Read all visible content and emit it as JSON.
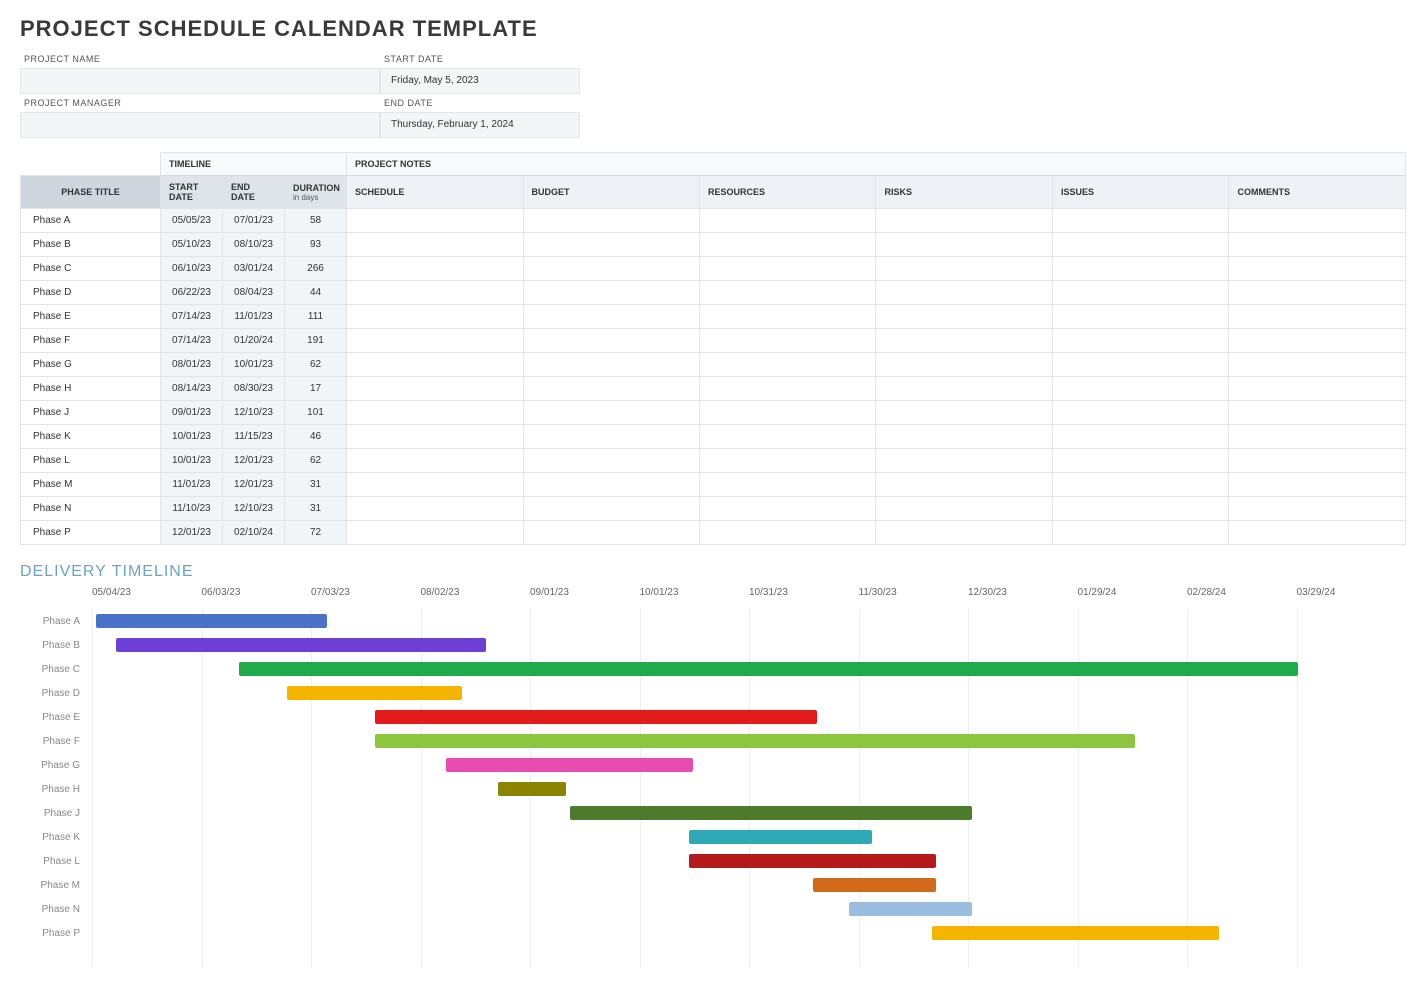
{
  "title": "PROJECT SCHEDULE CALENDAR TEMPLATE",
  "meta": {
    "project_name_label": "PROJECT NAME",
    "project_name_value": "",
    "project_manager_label": "PROJECT MANAGER",
    "project_manager_value": "",
    "start_date_label": "START DATE",
    "start_date_value": "Friday, May 5, 2023",
    "end_date_label": "END DATE",
    "end_date_value": "Thursday, February 1, 2024"
  },
  "table": {
    "group_timeline": "TIMELINE",
    "group_notes": "PROJECT NOTES",
    "headers": {
      "phase_title": "PHASE TITLE",
      "start_date": "START DATE",
      "end_date": "END DATE",
      "duration": "DURATION",
      "duration_sub": "in days",
      "schedule": "SCHEDULE",
      "budget": "BUDGET",
      "resources": "RESOURCES",
      "risks": "RISKS",
      "issues": "ISSUES",
      "comments": "COMMENTS"
    },
    "rows": [
      {
        "phase": "Phase A",
        "start": "05/05/23",
        "end": "07/01/23",
        "dur": "58"
      },
      {
        "phase": "Phase B",
        "start": "05/10/23",
        "end": "08/10/23",
        "dur": "93"
      },
      {
        "phase": "Phase C",
        "start": "06/10/23",
        "end": "03/01/24",
        "dur": "266"
      },
      {
        "phase": "Phase D",
        "start": "06/22/23",
        "end": "08/04/23",
        "dur": "44"
      },
      {
        "phase": "Phase E",
        "start": "07/14/23",
        "end": "11/01/23",
        "dur": "111"
      },
      {
        "phase": "Phase F",
        "start": "07/14/23",
        "end": "01/20/24",
        "dur": "191"
      },
      {
        "phase": "Phase G",
        "start": "08/01/23",
        "end": "10/01/23",
        "dur": "62"
      },
      {
        "phase": "Phase H",
        "start": "08/14/23",
        "end": "08/30/23",
        "dur": "17"
      },
      {
        "phase": "Phase J",
        "start": "09/01/23",
        "end": "12/10/23",
        "dur": "101"
      },
      {
        "phase": "Phase K",
        "start": "10/01/23",
        "end": "11/15/23",
        "dur": "46"
      },
      {
        "phase": "Phase L",
        "start": "10/01/23",
        "end": "12/01/23",
        "dur": "62"
      },
      {
        "phase": "Phase M",
        "start": "11/01/23",
        "end": "12/01/23",
        "dur": "31"
      },
      {
        "phase": "Phase N",
        "start": "11/10/23",
        "end": "12/10/23",
        "dur": "31"
      },
      {
        "phase": "Phase P",
        "start": "12/01/23",
        "end": "02/10/24",
        "dur": "72"
      }
    ]
  },
  "delivery_heading": "DELIVERY TIMELINE",
  "chart_data": {
    "type": "bar",
    "title": "DELIVERY TIMELINE",
    "xlabel": "",
    "ylabel": "",
    "x_ticks": [
      "05/04/23",
      "06/03/23",
      "07/03/23",
      "08/02/23",
      "09/01/23",
      "10/01/23",
      "10/31/23",
      "11/30/23",
      "12/30/23",
      "01/29/24",
      "02/28/24",
      "03/29/24"
    ],
    "x_range_days": 330,
    "x_origin": "05/04/23",
    "series": [
      {
        "name": "Phase A",
        "start_offset_days": 1,
        "duration_days": 58,
        "color": "#4a72c9"
      },
      {
        "name": "Phase B",
        "start_offset_days": 6,
        "duration_days": 93,
        "color": "#6d3fd6"
      },
      {
        "name": "Phase C",
        "start_offset_days": 37,
        "duration_days": 266,
        "color": "#1fab4b"
      },
      {
        "name": "Phase D",
        "start_offset_days": 49,
        "duration_days": 44,
        "color": "#f5b400"
      },
      {
        "name": "Phase E",
        "start_offset_days": 71,
        "duration_days": 111,
        "color": "#e31b1b"
      },
      {
        "name": "Phase F",
        "start_offset_days": 71,
        "duration_days": 191,
        "color": "#8cc63f"
      },
      {
        "name": "Phase G",
        "start_offset_days": 89,
        "duration_days": 62,
        "color": "#e84cb0"
      },
      {
        "name": "Phase H",
        "start_offset_days": 102,
        "duration_days": 17,
        "color": "#8a8400"
      },
      {
        "name": "Phase J",
        "start_offset_days": 120,
        "duration_days": 101,
        "color": "#4d7a2b"
      },
      {
        "name": "Phase K",
        "start_offset_days": 150,
        "duration_days": 46,
        "color": "#2fa8b5"
      },
      {
        "name": "Phase L",
        "start_offset_days": 150,
        "duration_days": 62,
        "color": "#b51a1a"
      },
      {
        "name": "Phase M",
        "start_offset_days": 181,
        "duration_days": 31,
        "color": "#d16a1a"
      },
      {
        "name": "Phase N",
        "start_offset_days": 190,
        "duration_days": 31,
        "color": "#9bbde0"
      },
      {
        "name": "Phase P",
        "start_offset_days": 211,
        "duration_days": 72,
        "color": "#f5b400"
      }
    ]
  }
}
